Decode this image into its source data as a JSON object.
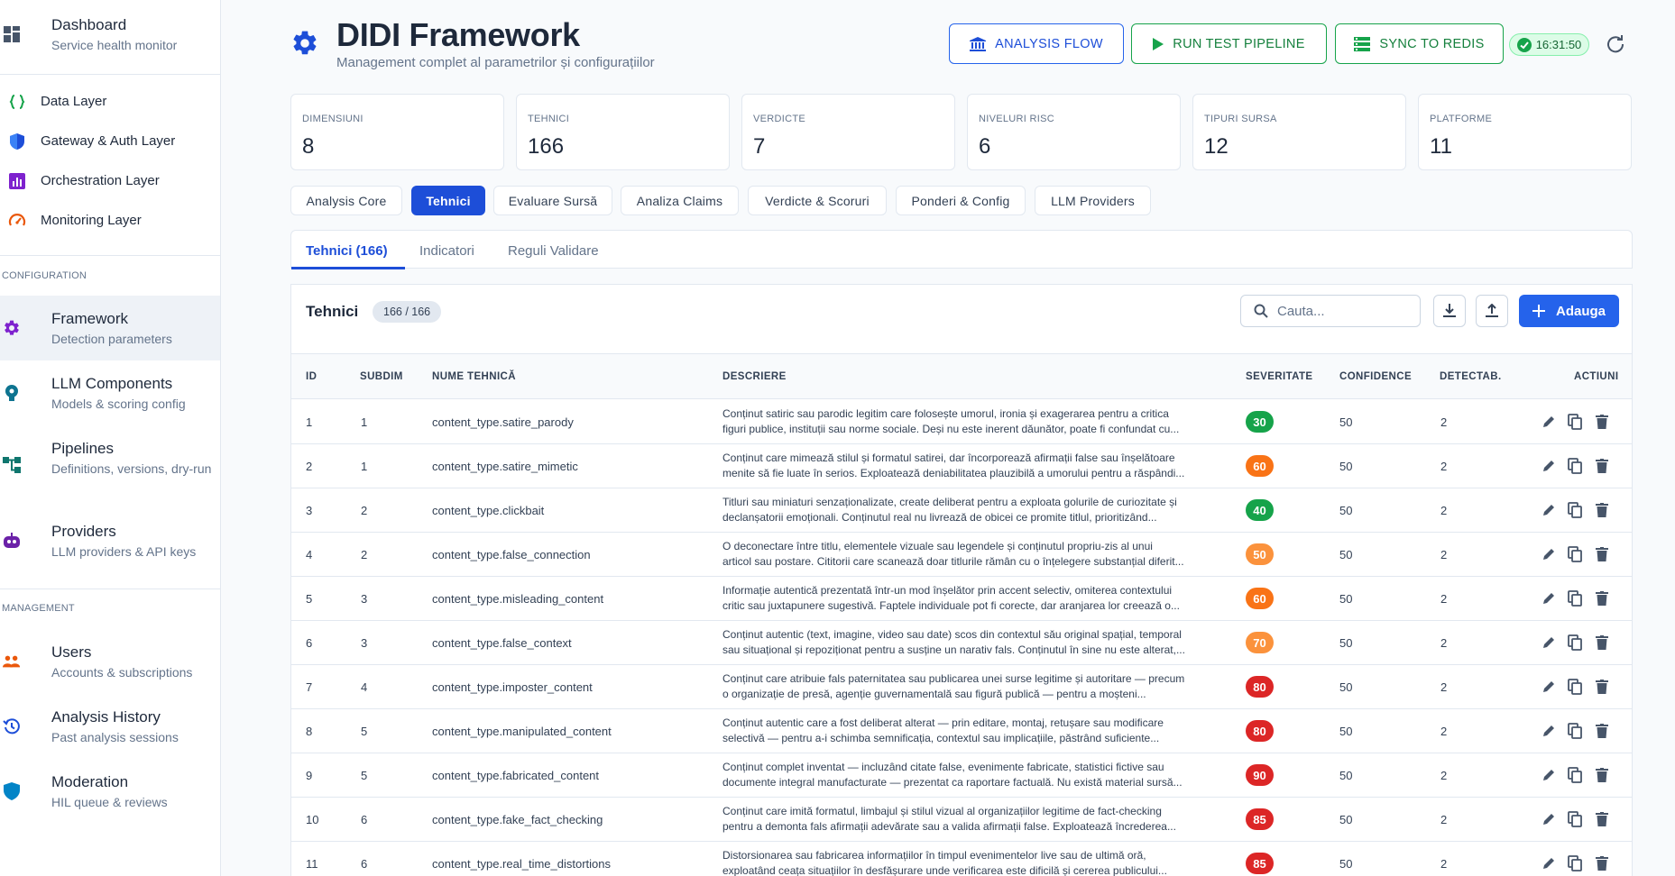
{
  "sidebar": {
    "dashboard": {
      "label": "Dashboard",
      "sub": "Service health monitor",
      "icon": "grid-icon"
    },
    "layers": [
      {
        "label": "Data Layer",
        "icon": "braces-icon",
        "color": "#16a34a"
      },
      {
        "label": "Gateway & Auth Layer",
        "icon": "shield-icon",
        "color": "#1d4ed8"
      },
      {
        "label": "Orchestration Layer",
        "icon": "bar-chart-icon",
        "color": "#7e22ce"
      },
      {
        "label": "Monitoring Layer",
        "icon": "speedometer-icon",
        "color": "#ea580c"
      }
    ],
    "config_section": "CONFIGURATION",
    "config_items": [
      {
        "label": "Framework",
        "sub": "Detection parameters",
        "icon": "gear-icon",
        "color": "#7e22ce"
      },
      {
        "label": "LLM Components",
        "sub": "Models & scoring config",
        "icon": "brain-icon",
        "color": "#0e7490"
      },
      {
        "label": "Pipelines",
        "sub": "Definitions, versions, dry-run",
        "icon": "pipeline-icon",
        "color": "#0f766e"
      },
      {
        "label": "Providers",
        "sub": "LLM providers & API keys",
        "icon": "robot-icon",
        "color": "#6b21a8"
      }
    ],
    "management_section": "MANAGEMENT",
    "management_items": [
      {
        "label": "Users",
        "sub": "Accounts & subscriptions",
        "icon": "users-icon",
        "color": "#ea580c"
      },
      {
        "label": "Analysis History",
        "sub": "Past analysis sessions",
        "icon": "history-icon",
        "color": "#1d4ed8"
      },
      {
        "label": "Moderation",
        "sub": "HIL queue & reviews",
        "icon": "shield-filled-icon",
        "color": "#0284c7"
      }
    ]
  },
  "header": {
    "title": "DIDI Framework",
    "subtitle": "Management complet al parametrilor și configurațiilor",
    "btn_analysis": "ANALYSIS FLOW",
    "btn_run": "RUN TEST PIPELINE",
    "btn_sync": "SYNC TO REDIS",
    "time": "16:31:50"
  },
  "stats": [
    {
      "label": "DIMENSIUNI",
      "value": "8"
    },
    {
      "label": "TEHNICI",
      "value": "166"
    },
    {
      "label": "VERDICTE",
      "value": "7"
    },
    {
      "label": "NIVELURI RISC",
      "value": "6"
    },
    {
      "label": "TIPURI SURSA",
      "value": "12"
    },
    {
      "label": "PLATFORME",
      "value": "11"
    }
  ],
  "category_tabs": [
    "Analysis Core",
    "Tehnici",
    "Evaluare Sursă",
    "Analiza Claims",
    "Verdicte & Scoruri",
    "Ponderi & Config",
    "LLM Providers"
  ],
  "sub_tabs": [
    "Tehnici (166)",
    "Indicatori",
    "Reguli Validare"
  ],
  "table": {
    "title": "Tehnici",
    "count": "166 / 166",
    "search_placeholder": "Cauta...",
    "add_label": "Adauga",
    "columns": [
      "ID",
      "SUBDIM",
      "NUME TEHNICĂ",
      "DESCRIERE",
      "SEVERITATE",
      "CONFIDENCE",
      "DETECTAB.",
      "ACTIUNI"
    ],
    "rows": [
      {
        "id": "1",
        "subdim": "1",
        "name": "content_type.satire_parody",
        "d1": "Conținut satiric sau parodic legitim care folosește umorul, ironia și exagerarea pentru a critica",
        "d2": "figuri publice, instituții sau norme sociale. Deși nu este inerent dăunător, poate fi confundat cu...",
        "sev": "30",
        "sev_color": "#16a34a",
        "conf": "50",
        "det": "2"
      },
      {
        "id": "2",
        "subdim": "1",
        "name": "content_type.satire_mimetic",
        "d1": "Conținut care mimează stilul și formatul satirei, dar încorporează afirmații false sau înșelătoare",
        "d2": "menite să fie luate în serios. Exploatează deniabilitatea plauzibilă a umorului pentru a răspândi...",
        "sev": "60",
        "sev_color": "#f97316",
        "conf": "50",
        "det": "2"
      },
      {
        "id": "3",
        "subdim": "2",
        "name": "content_type.clickbait",
        "d1": "Titluri sau miniaturi senzaționalizate, create deliberat pentru a exploata golurile de curiozitate și",
        "d2": "declanșatorii emoționali. Conținutul real nu livrează de obicei ce promite titlul, prioritizând...",
        "sev": "40",
        "sev_color": "#16a34a",
        "conf": "50",
        "det": "2"
      },
      {
        "id": "4",
        "subdim": "2",
        "name": "content_type.false_connection",
        "d1": "O deconectare între titlu, elementele vizuale sau legendele și conținutul propriu-zis al unui",
        "d2": "articol sau postare. Cititorii care scanează doar titlurile rămân cu o înțelegere substanțial diferit...",
        "sev": "50",
        "sev_color": "#fb923c",
        "conf": "50",
        "det": "2"
      },
      {
        "id": "5",
        "subdim": "3",
        "name": "content_type.misleading_content",
        "d1": "Informație autentică prezentată într-un mod înșelător prin accent selectiv, omiterea contextului",
        "d2": "critic sau juxtapunere sugestivă. Faptele individuale pot fi corecte, dar aranjarea lor creează o...",
        "sev": "60",
        "sev_color": "#f97316",
        "conf": "50",
        "det": "2"
      },
      {
        "id": "6",
        "subdim": "3",
        "name": "content_type.false_context",
        "d1": "Conținut autentic (text, imagine, video sau date) scos din contextul său original spațial, temporal",
        "d2": "sau situațional și repoziționat pentru a susține un narativ fals. Conținutul în sine nu este alterat,...",
        "sev": "70",
        "sev_color": "#fb923c",
        "conf": "50",
        "det": "2"
      },
      {
        "id": "7",
        "subdim": "4",
        "name": "content_type.imposter_content",
        "d1": "Conținut care atribuie fals paternitatea sau publicarea unei surse legitime și autoritare — precum",
        "d2": "o organizație de presă, agenție guvernamentală sau figură publică — pentru a moșteni...",
        "sev": "80",
        "sev_color": "#dc2626",
        "conf": "50",
        "det": "2"
      },
      {
        "id": "8",
        "subdim": "5",
        "name": "content_type.manipulated_content",
        "d1": "Conținut autentic care a fost deliberat alterat — prin editare, montaj, retușare sau modificare",
        "d2": "selectivă — pentru a-i schimba semnificația, contextul sau implicațiile, păstrând suficiente...",
        "sev": "80",
        "sev_color": "#dc2626",
        "conf": "50",
        "det": "2"
      },
      {
        "id": "9",
        "subdim": "5",
        "name": "content_type.fabricated_content",
        "d1": "Conținut complet inventat — incluzând citate false, evenimente fabricate, statistici fictive sau",
        "d2": "documente integral manufacturate — prezentat ca raportare factuală. Nu există material sursă...",
        "sev": "90",
        "sev_color": "#dc2626",
        "conf": "50",
        "det": "2"
      },
      {
        "id": "10",
        "subdim": "6",
        "name": "content_type.fake_fact_checking",
        "d1": "Conținut care imită formatul, limbajul și stilul vizual al organizațiilor legitime de fact-checking",
        "d2": "pentru a demonta fals afirmații adevărate sau a valida afirmații false. Exploatează încrederea...",
        "sev": "85",
        "sev_color": "#dc2626",
        "conf": "50",
        "det": "2"
      },
      {
        "id": "11",
        "subdim": "6",
        "name": "content_type.real_time_distortions",
        "d1": "Distorsionarea sau fabricarea informațiilor în timpul evenimentelor live sau de ultimă oră,",
        "d2": "exploatând ceața situațiilor în desfășurare unde verificarea este dificilă și cererea publicului...",
        "sev": "85",
        "sev_color": "#dc2626",
        "conf": "50",
        "det": "2"
      }
    ]
  }
}
